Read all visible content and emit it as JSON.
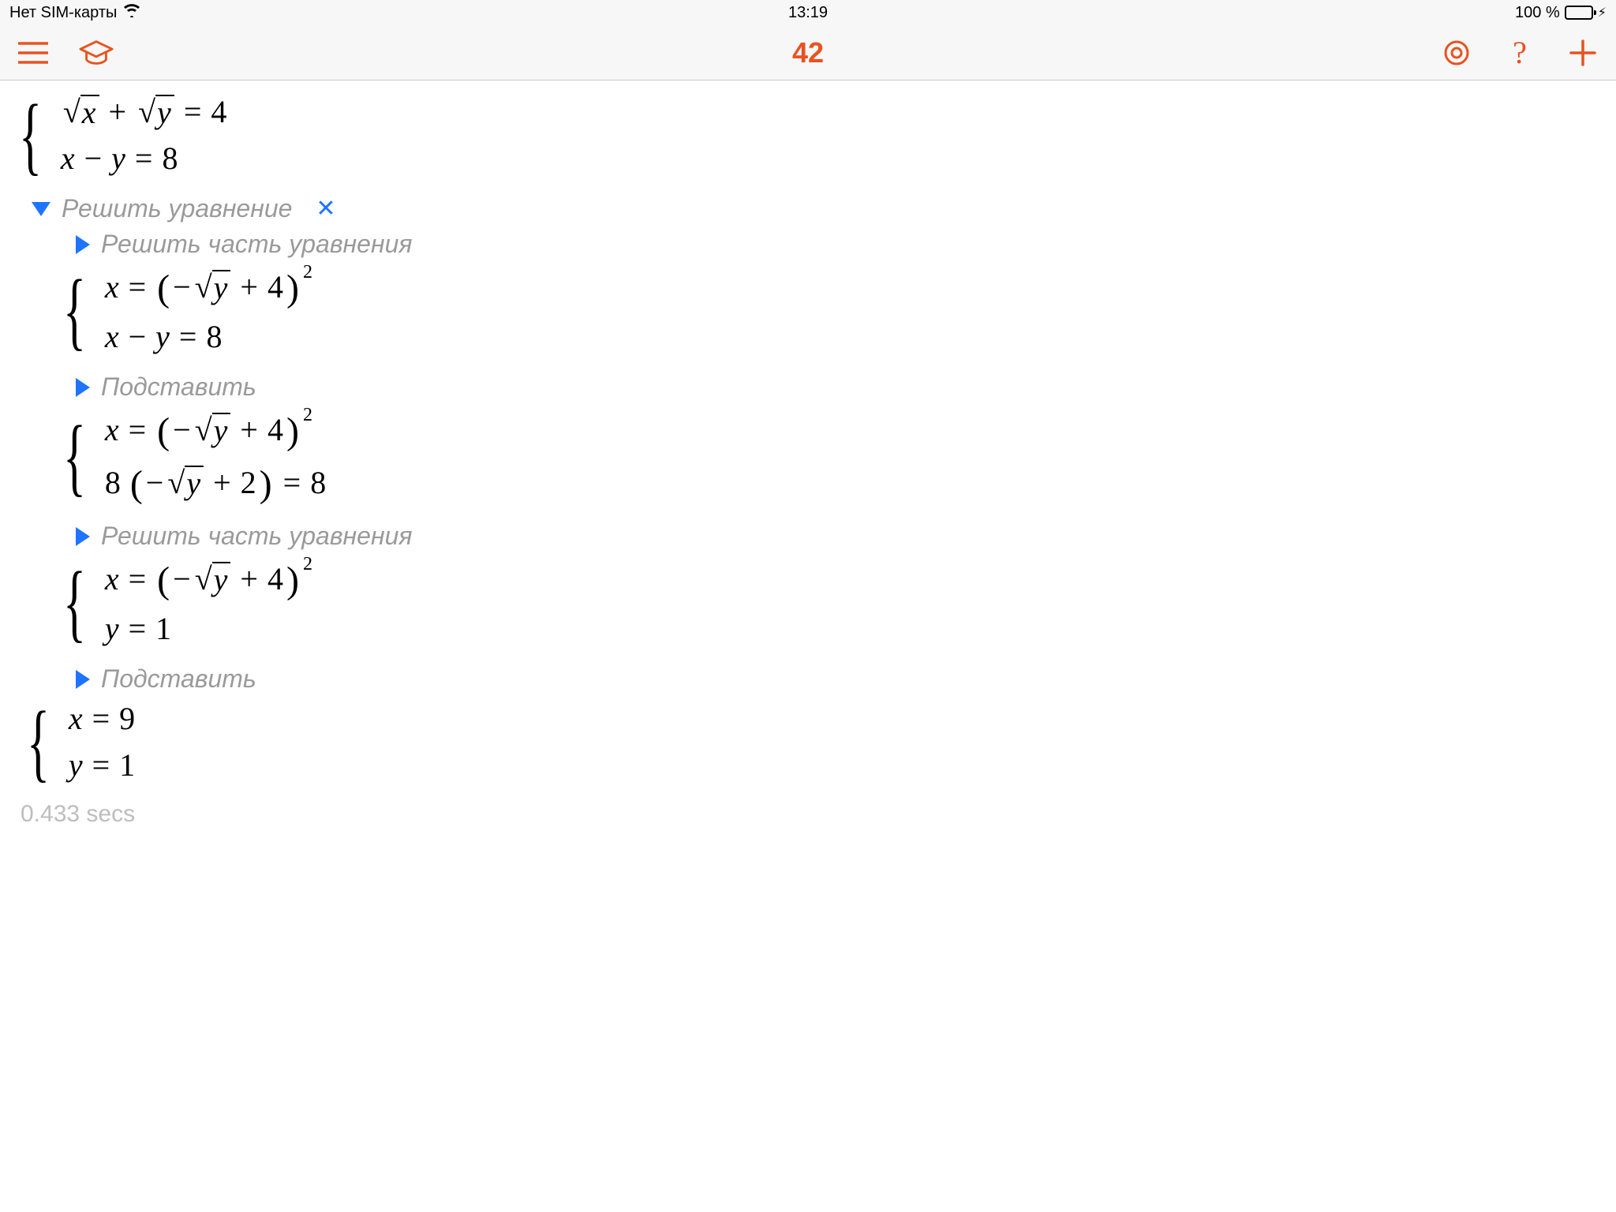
{
  "status": {
    "carrier": "Нет SIM-карты",
    "time": "13:19",
    "battery_text": "100 %"
  },
  "nav": {
    "title": "42"
  },
  "step_main": {
    "label": "Решить уравнение"
  },
  "step1": {
    "label": "Решить часть уравнения"
  },
  "step2": {
    "label": "Подставить"
  },
  "step3": {
    "label": "Решить часть уравнения"
  },
  "step4": {
    "label": "Подставить"
  },
  "eq": {
    "x": "x",
    "y": "y",
    "plus": "+",
    "minus": "−",
    "eq": "=",
    "n4": "4",
    "n8": "8",
    "n2": "2",
    "n1": "1",
    "n9": "9"
  },
  "timing": "0.433 secs"
}
